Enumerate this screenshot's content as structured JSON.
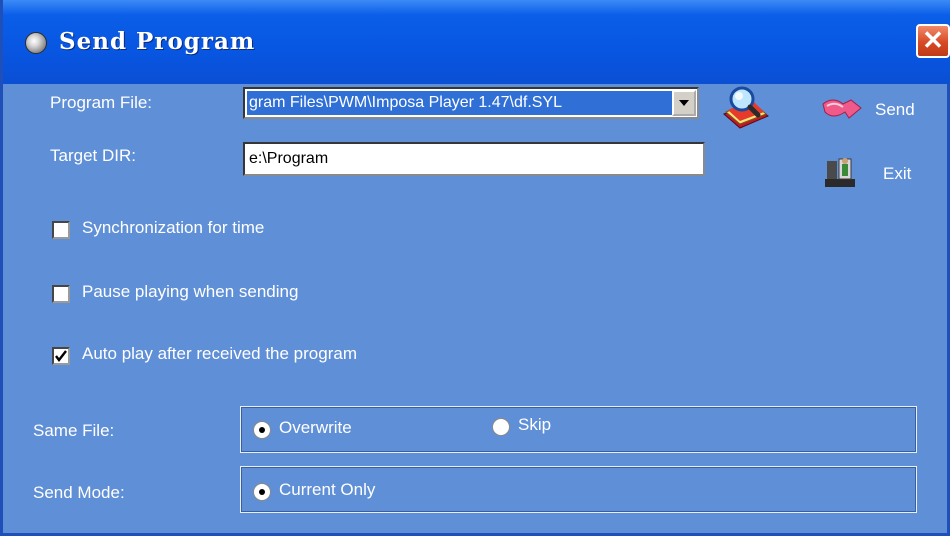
{
  "window": {
    "title": "Send Program",
    "close_label": "✕"
  },
  "program_file": {
    "label": "Program File:",
    "value": "gram Files\\PWM\\Imposa Player 1.47\\df.SYL"
  },
  "target_dir": {
    "label": "Target DIR:",
    "value": "e:\\Program"
  },
  "buttons": {
    "send_label": "Send",
    "exit_label": "Exit"
  },
  "options": [
    {
      "label": "Synchronization for time",
      "checked": false
    },
    {
      "label": "Pause playing when sending",
      "checked": false
    },
    {
      "label": "Auto play after received the program",
      "checked": true
    }
  ],
  "same_file": {
    "label": "Same File:",
    "options": [
      {
        "label": "Overwrite",
        "selected": true
      },
      {
        "label": "Skip",
        "selected": false
      }
    ]
  },
  "send_mode": {
    "label": "Send Mode:",
    "options": [
      {
        "label": "Current Only",
        "selected": true
      }
    ]
  },
  "colors": {
    "dialog_bg": "#5f8fd6",
    "titlebar": "#0856e2",
    "close_button": "#d74a25"
  },
  "icons": [
    "window-system-icon",
    "close-icon",
    "dropdown-arrow-icon",
    "browse-icon",
    "send-icon",
    "exit-icon"
  ]
}
